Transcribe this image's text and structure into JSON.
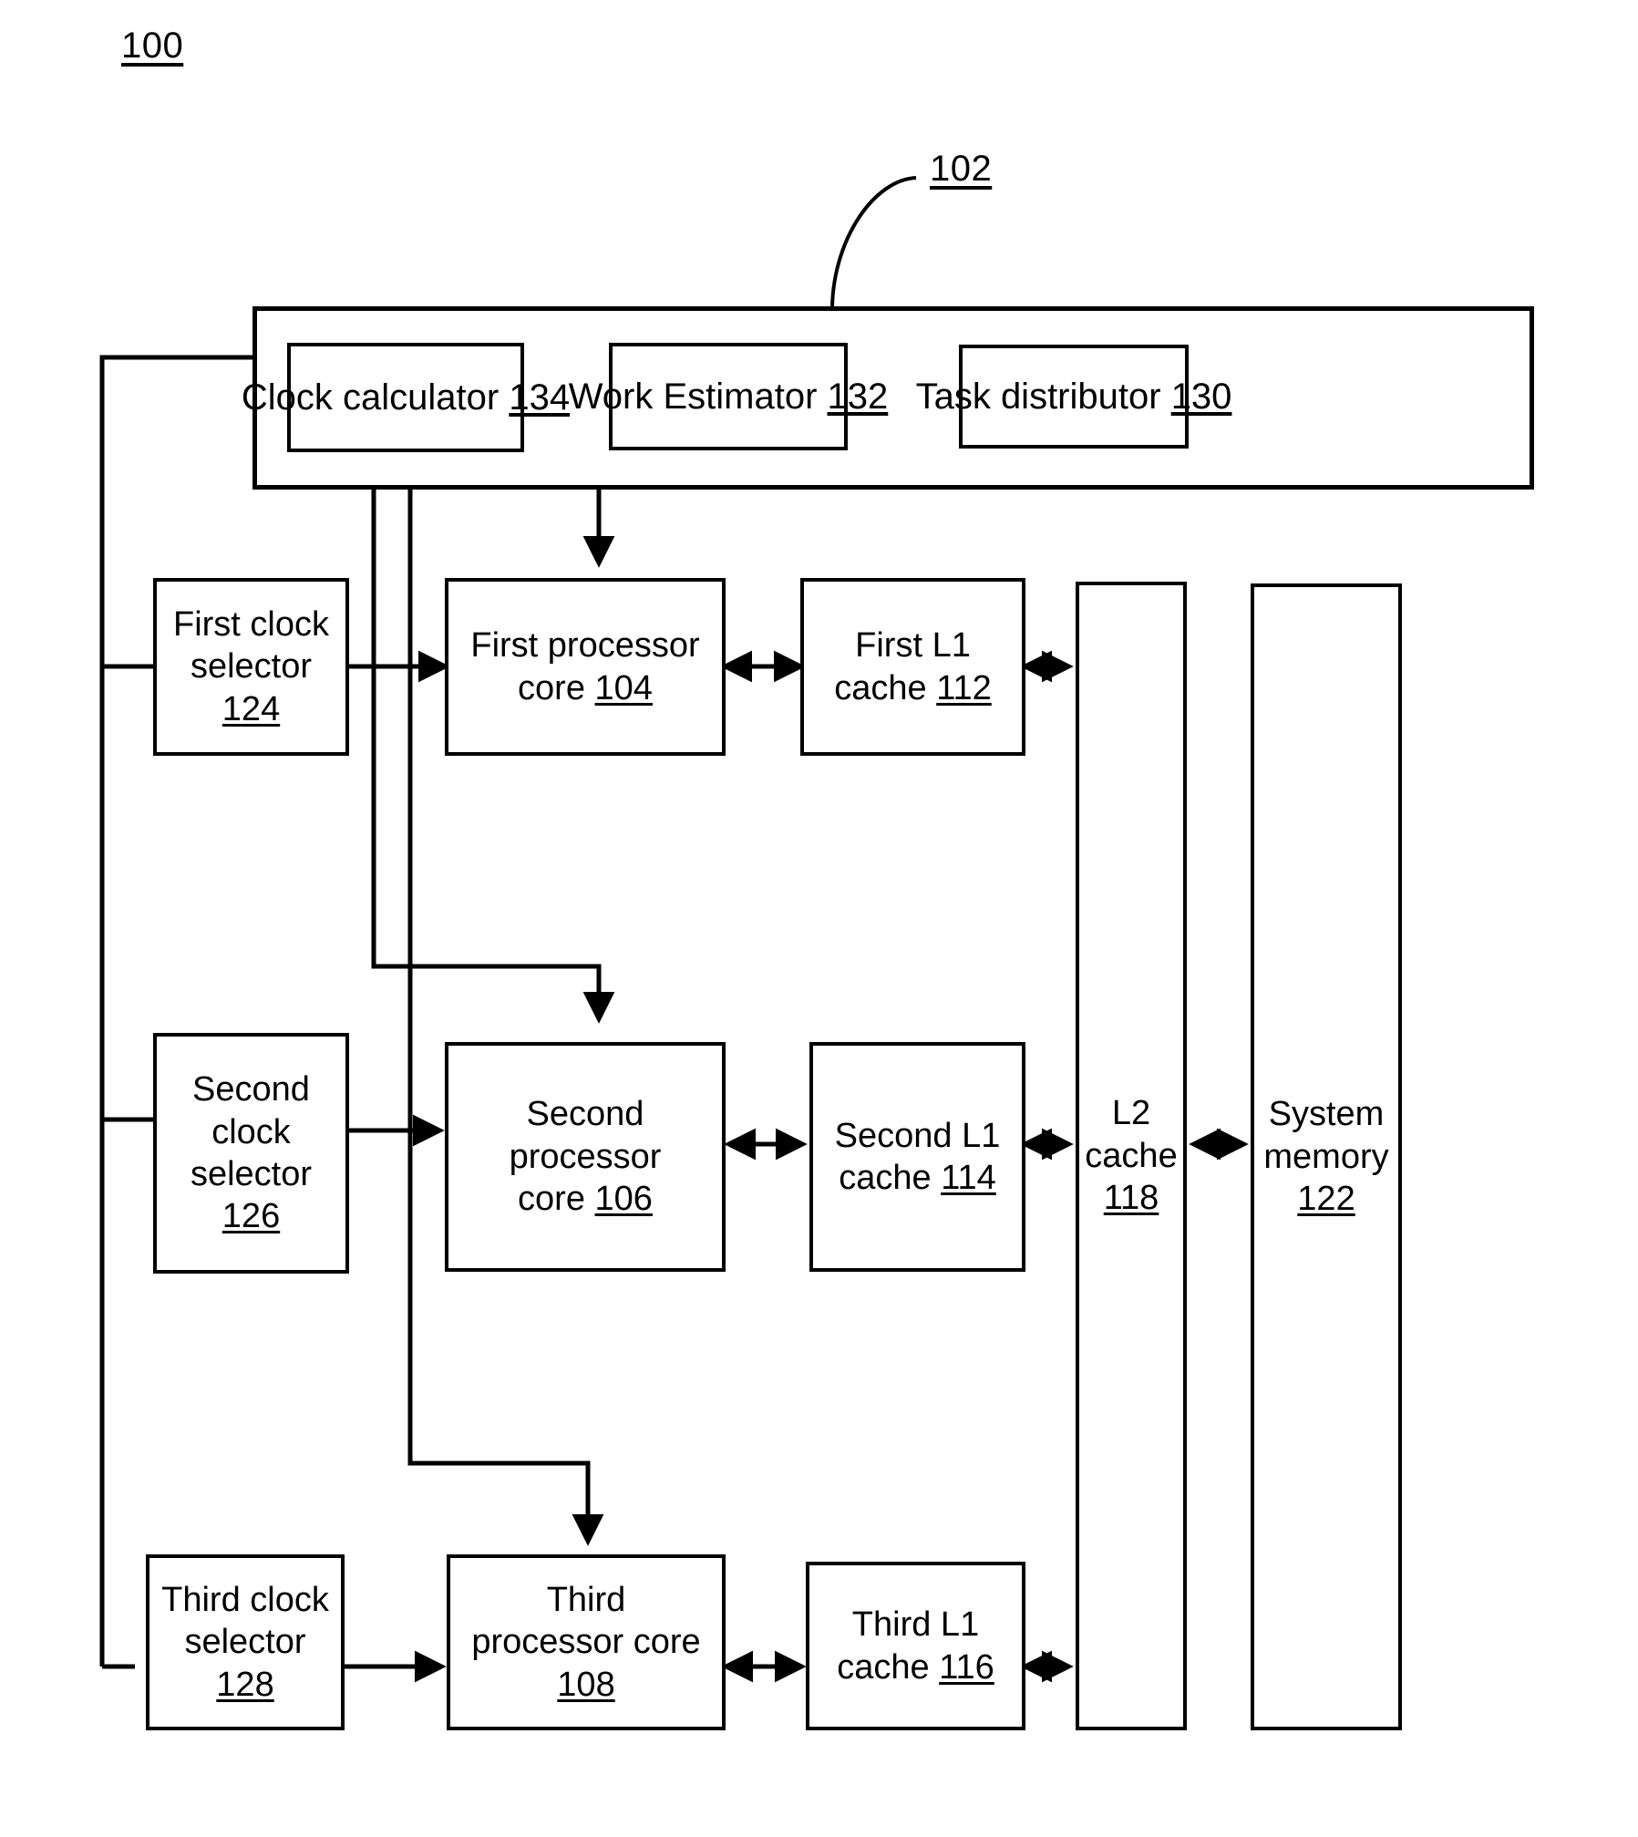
{
  "figure": {
    "figure_number": "100",
    "system_ref": "102"
  },
  "controller": {
    "modules": [
      {
        "name": "clock-calculator",
        "label": "Clock calculator",
        "ref": "134"
      },
      {
        "name": "work-estimator",
        "label": "Work Estimator",
        "ref": "132"
      },
      {
        "name": "task-distributor",
        "label": "Task distributor",
        "ref": "130"
      }
    ]
  },
  "clock_selectors": [
    {
      "name": "first-clock-selector",
      "line1": "First clock",
      "line2": "selector",
      "ref": "124"
    },
    {
      "name": "second-clock-selector",
      "line1": "Second",
      "line2": "clock",
      "line3": "selector",
      "ref": "126"
    },
    {
      "name": "third-clock-selector",
      "line1": "Third clock",
      "line2": "selector",
      "ref": "128"
    }
  ],
  "processor_cores": [
    {
      "name": "first-processor-core",
      "line1": "First processor",
      "line2": "core",
      "ref": "104"
    },
    {
      "name": "second-processor-core",
      "line1": "Second",
      "line2": "processor",
      "line3": "core",
      "ref": "106"
    },
    {
      "name": "third-processor-core",
      "line1": "Third",
      "line2": "processor core",
      "ref": "108"
    }
  ],
  "l1_caches": [
    {
      "name": "first-l1-cache",
      "line1": "First L1",
      "line2": "cache",
      "ref": "112"
    },
    {
      "name": "second-l1-cache",
      "line1": "Second L1",
      "line2": "cache",
      "ref": "114"
    },
    {
      "name": "third-l1-cache",
      "line1": "Third L1",
      "line2": "cache",
      "ref": "116"
    }
  ],
  "l2_cache": {
    "name": "l2-cache",
    "line1": "L2",
    "line2": "cache",
    "ref": "118"
  },
  "system_memory": {
    "name": "system-memory",
    "line1": "System",
    "line2": "memory",
    "ref": "122"
  },
  "colors": {
    "stroke": "#000000",
    "background": "#ffffff"
  }
}
